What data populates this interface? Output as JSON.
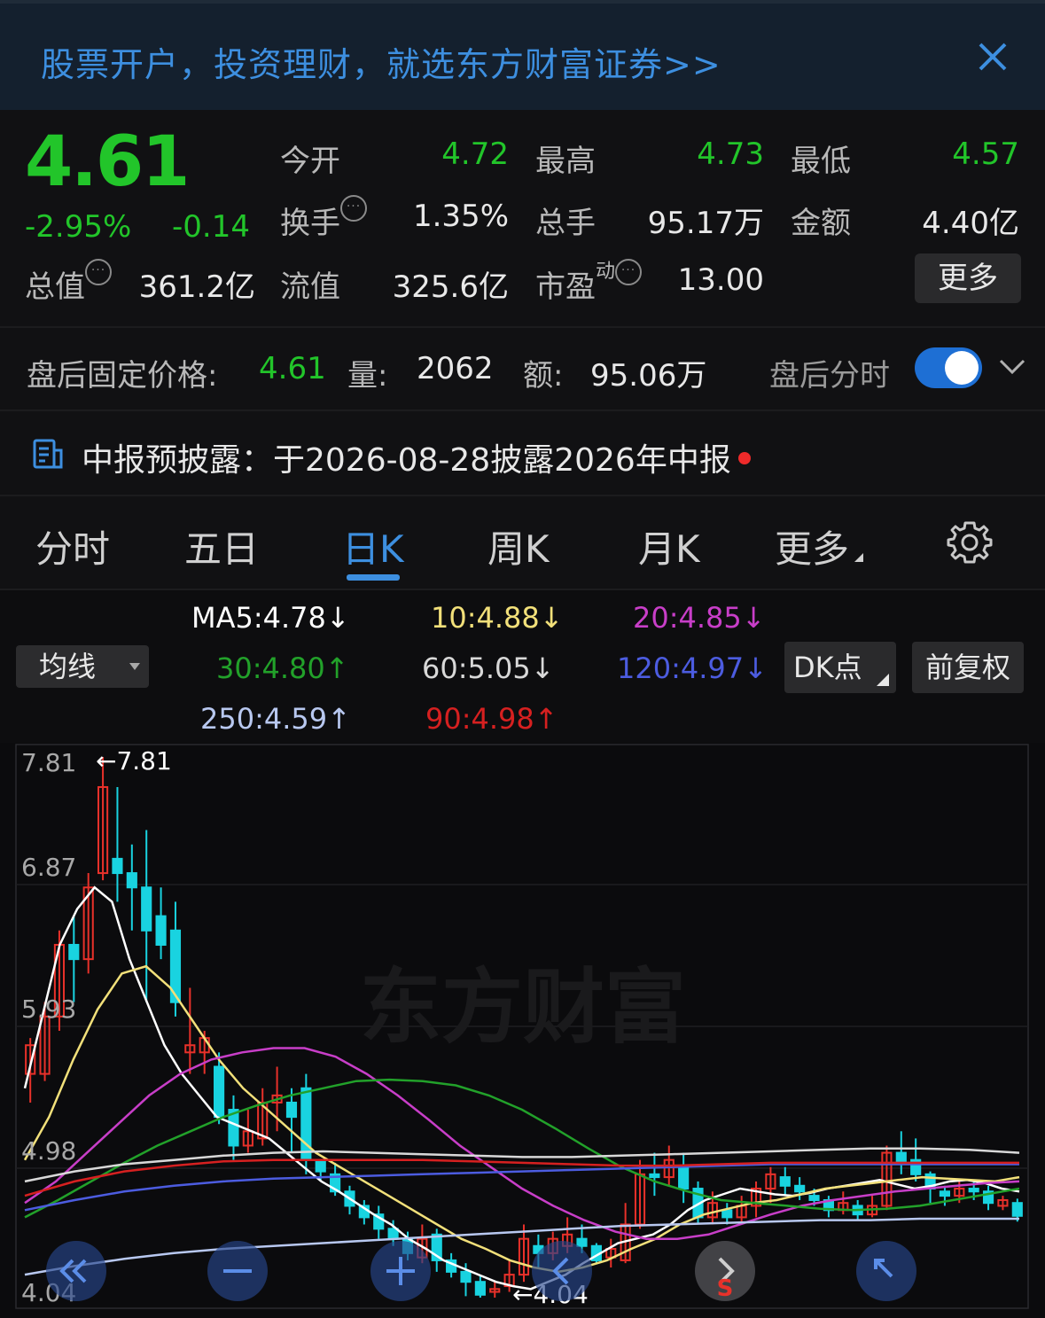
{
  "banner": {
    "text": "股票开户，投资理财，就选东方财富证券>>"
  },
  "quote": {
    "price": "4.61",
    "change_pct": "-2.95%",
    "change": "-0.14",
    "open_label": "今开",
    "open": "4.72",
    "high_label": "最高",
    "high": "4.73",
    "low_label": "最低",
    "low": "4.57",
    "turnover_label": "换手",
    "turnover": "1.35%",
    "volume_label": "总手",
    "volume": "95.17万",
    "amount_label": "金额",
    "amount": "4.40亿",
    "mktcap_label": "总值",
    "mktcap": "361.2亿",
    "float_label": "流值",
    "float": "325.6亿",
    "pe_label": "市盈",
    "pe_sup": "动",
    "pe": "13.00",
    "more_label": "更多"
  },
  "after_hours": {
    "price_label": "盘后固定价格:",
    "price": "4.61",
    "vol_label": "量:",
    "vol": "2062",
    "amt_label": "额:",
    "amt": "95.06万",
    "intraday_label": "盘后分时"
  },
  "notice": {
    "text": "中报预披露：于2026-08-28披露2026年中报"
  },
  "tabs": [
    {
      "label": "分时"
    },
    {
      "label": "五日"
    },
    {
      "label": "日K"
    },
    {
      "label": "周K"
    },
    {
      "label": "月K"
    },
    {
      "label": "更多"
    }
  ],
  "ma": {
    "selector": "均线",
    "ma5": "MA5:4.78↓",
    "ma10": "10:4.88↓",
    "ma20": "20:4.85↓",
    "ma30": "30:4.80↑",
    "ma60": "60:5.05↓",
    "ma120": "120:4.97↓",
    "ma250": "250:4.59↑",
    "ma90": "90:4.98↑",
    "dk_label": "DK点",
    "adjust_label": "前复权"
  },
  "colors": {
    "up": "#e8312a",
    "down": "#19d3e0",
    "ma5": "#ffffff",
    "ma10": "#f2e07a",
    "ma20": "#c83ec8",
    "ma30": "#22a12a",
    "ma60": "#d8d8d8",
    "ma120": "#4c5ce0",
    "ma250": "#b8c8f0",
    "ma90": "#d62020"
  },
  "chart_data": {
    "type": "candlestick",
    "watermark": "东方财富",
    "y_ticks": [
      "7.81",
      "6.87",
      "5.93",
      "4.98",
      "4.04"
    ],
    "ylim": [
      4.04,
      7.81
    ],
    "max_label": "←7.81",
    "min_label": "←4.04",
    "candles": [
      [
        5.6,
        5.8,
        5.4,
        5.85
      ],
      [
        5.6,
        6.0,
        5.55,
        6.1
      ],
      [
        6.0,
        6.5,
        5.9,
        6.6
      ],
      [
        6.5,
        6.4,
        6.1,
        6.7
      ],
      [
        6.4,
        6.9,
        6.3,
        7.0
      ],
      [
        7.0,
        7.6,
        6.95,
        7.81
      ],
      [
        7.1,
        7.0,
        6.8,
        7.6
      ],
      [
        7.0,
        6.9,
        6.6,
        7.2
      ],
      [
        6.9,
        6.6,
        6.1,
        7.3
      ],
      [
        6.7,
        6.5,
        6.4,
        6.9
      ],
      [
        6.6,
        6.1,
        6.0,
        6.8
      ],
      [
        5.75,
        5.8,
        5.6,
        6.2
      ],
      [
        5.75,
        5.85,
        5.6,
        5.9
      ],
      [
        5.65,
        5.3,
        5.25,
        5.75
      ],
      [
        5.35,
        5.1,
        5.0,
        5.45
      ],
      [
        5.1,
        5.2,
        5.05,
        5.35
      ],
      [
        5.15,
        5.4,
        5.1,
        5.5
      ],
      [
        5.4,
        5.45,
        5.2,
        5.65
      ],
      [
        5.4,
        5.3,
        5.05,
        5.5
      ],
      [
        5.5,
        5.0,
        4.9,
        5.6
      ],
      [
        5.0,
        4.92,
        4.85,
        5.0
      ],
      [
        4.9,
        4.78,
        4.75,
        4.98
      ],
      [
        4.78,
        4.68,
        4.62,
        4.82
      ],
      [
        4.68,
        4.6,
        4.55,
        4.72
      ],
      [
        4.62,
        4.52,
        4.45,
        4.68
      ],
      [
        4.52,
        4.45,
        4.4,
        4.58
      ],
      [
        4.45,
        4.35,
        4.3,
        4.5
      ],
      [
        4.32,
        4.45,
        4.28,
        4.55
      ],
      [
        4.48,
        4.3,
        4.22,
        4.52
      ],
      [
        4.3,
        4.22,
        4.18,
        4.35
      ],
      [
        4.22,
        4.15,
        4.05,
        4.28
      ],
      [
        4.15,
        4.06,
        4.04,
        4.2
      ],
      [
        4.08,
        4.1,
        4.04,
        4.15
      ],
      [
        4.12,
        4.2,
        4.08,
        4.3
      ],
      [
        4.2,
        4.45,
        4.15,
        4.55
      ],
      [
        4.4,
        4.35,
        4.25,
        4.48
      ],
      [
        4.35,
        4.45,
        4.3,
        4.5
      ],
      [
        4.4,
        4.48,
        4.35,
        4.6
      ],
      [
        4.45,
        4.4,
        4.35,
        4.55
      ],
      [
        4.4,
        4.3,
        4.28,
        4.42
      ],
      [
        4.32,
        4.38,
        4.25,
        4.45
      ],
      [
        4.3,
        4.55,
        4.28,
        4.7
      ],
      [
        4.55,
        4.9,
        4.52,
        5.0
      ],
      [
        4.9,
        4.88,
        4.75,
        5.05
      ],
      [
        4.88,
        5.0,
        4.82,
        5.1
      ],
      [
        4.95,
        4.8,
        4.7,
        5.05
      ],
      [
        4.8,
        4.6,
        4.55,
        4.85
      ],
      [
        4.6,
        4.7,
        4.55,
        4.78
      ],
      [
        4.65,
        4.6,
        4.55,
        4.7
      ],
      [
        4.6,
        4.68,
        4.55,
        4.75
      ],
      [
        4.68,
        4.8,
        4.6,
        4.85
      ],
      [
        4.8,
        4.9,
        4.7,
        4.95
      ],
      [
        4.88,
        4.82,
        4.75,
        4.95
      ],
      [
        4.82,
        4.78,
        4.72,
        4.88
      ],
      [
        4.75,
        4.72,
        4.68,
        4.8
      ],
      [
        4.72,
        4.65,
        4.6,
        4.75
      ],
      [
        4.65,
        4.7,
        4.62,
        4.78
      ],
      [
        4.68,
        4.62,
        4.58,
        4.72
      ],
      [
        4.62,
        4.68,
        4.6,
        4.75
      ],
      [
        4.68,
        5.05,
        4.65,
        5.1
      ],
      [
        5.05,
        4.98,
        4.9,
        5.2
      ],
      [
        5.0,
        4.9,
        4.85,
        5.15
      ],
      [
        4.9,
        4.8,
        4.7,
        4.92
      ],
      [
        4.78,
        4.75,
        4.68,
        4.82
      ],
      [
        4.75,
        4.8,
        4.7,
        4.85
      ],
      [
        4.8,
        4.78,
        4.72,
        4.85
      ],
      [
        4.78,
        4.7,
        4.65,
        4.82
      ],
      [
        4.68,
        4.72,
        4.65,
        4.75
      ],
      [
        4.7,
        4.61,
        4.57,
        4.73
      ]
    ],
    "candle_fields": [
      "open",
      "close",
      "low",
      "high"
    ],
    "series": [
      {
        "name": "MA5",
        "values": [
          5.5,
          6.0,
          6.5,
          6.75,
          6.9,
          6.8,
          6.4,
          6.1,
          5.8,
          5.6,
          5.45,
          5.3,
          5.25,
          5.2,
          5.15,
          5.05,
          4.95,
          4.85,
          4.78,
          4.7,
          4.62,
          4.55,
          4.45,
          4.38,
          4.3,
          4.25,
          4.2,
          4.15,
          4.12,
          4.1,
          4.15,
          4.2,
          4.28,
          4.35,
          4.42,
          4.45,
          4.48,
          4.55,
          4.65,
          4.72,
          4.76,
          4.8,
          4.78,
          4.76,
          4.75,
          4.77,
          4.8,
          4.82,
          4.84,
          4.86,
          4.83,
          4.8,
          4.82,
          4.85,
          4.86,
          4.84,
          4.8,
          4.78
        ]
      },
      {
        "name": "10",
        "values": [
          5.0,
          5.3,
          5.7,
          6.05,
          6.3,
          6.35,
          6.2,
          5.95,
          5.7,
          5.5,
          5.35,
          5.2,
          5.05,
          4.95,
          4.85,
          4.75,
          4.65,
          4.55,
          4.45,
          4.38,
          4.3,
          4.25,
          4.22,
          4.25,
          4.3,
          4.38,
          4.45,
          4.55,
          4.62,
          4.66,
          4.7,
          4.72,
          4.76,
          4.8,
          4.82,
          4.84,
          4.86,
          4.88,
          4.87,
          4.86,
          4.85,
          4.88
        ]
      },
      {
        "name": "20",
        "values": [
          4.7,
          4.85,
          5.05,
          5.25,
          5.45,
          5.6,
          5.7,
          5.75,
          5.78,
          5.78,
          5.72,
          5.6,
          5.45,
          5.28,
          5.1,
          4.95,
          4.8,
          4.68,
          4.58,
          4.5,
          4.45,
          4.45,
          4.48,
          4.55,
          4.62,
          4.68,
          4.72,
          4.75,
          4.78,
          4.8,
          4.82,
          4.84,
          4.85
        ]
      },
      {
        "name": "30",
        "values": [
          4.6,
          4.72,
          4.85,
          4.98,
          5.1,
          5.2,
          5.3,
          5.38,
          5.45,
          5.5,
          5.55,
          5.56,
          5.55,
          5.52,
          5.45,
          5.35,
          5.22,
          5.08,
          4.95,
          4.85,
          4.78,
          4.72,
          4.7,
          4.68,
          4.66,
          4.65,
          4.66,
          4.68,
          4.72,
          4.76,
          4.8
        ]
      },
      {
        "name": "60",
        "values": [
          4.85,
          4.92,
          4.97,
          5.0,
          5.03,
          5.05,
          5.06,
          5.05,
          5.04,
          5.03,
          5.02,
          5.02,
          5.03,
          5.04,
          5.05,
          5.06,
          5.07,
          5.08,
          5.08,
          5.07,
          5.05
        ]
      },
      {
        "name": "120",
        "values": [
          4.65,
          4.72,
          4.78,
          4.82,
          4.85,
          4.87,
          4.88,
          4.89,
          4.9,
          4.91,
          4.92,
          4.93,
          4.94,
          4.95,
          4.96,
          4.97,
          4.97,
          4.97,
          4.97,
          4.97,
          4.97
        ]
      },
      {
        "name": "250",
        "values": [
          4.2,
          4.26,
          4.31,
          4.35,
          4.38,
          4.4,
          4.42,
          4.44,
          4.46,
          4.48,
          4.5,
          4.52,
          4.54,
          4.55,
          4.56,
          4.57,
          4.58,
          4.58,
          4.59,
          4.59,
          4.59
        ]
      },
      {
        "name": "90",
        "values": [
          4.75,
          4.85,
          4.92,
          4.96,
          4.99,
          5.0,
          5.0,
          5.0,
          5.0,
          4.99,
          4.98,
          4.97,
          4.96,
          4.96,
          4.97,
          4.98,
          4.98,
          4.98,
          4.98,
          4.98,
          4.98
        ]
      }
    ]
  }
}
